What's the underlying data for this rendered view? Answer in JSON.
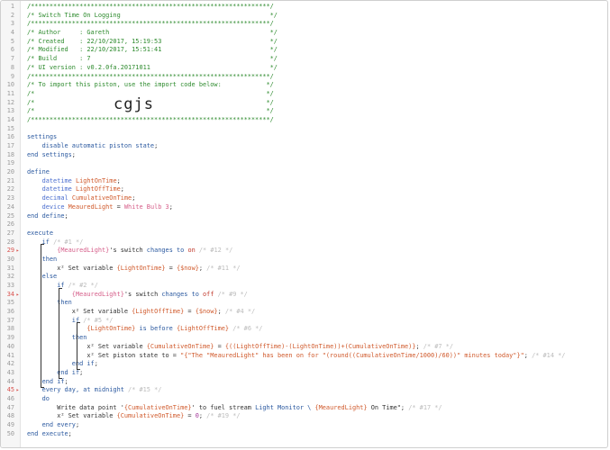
{
  "editor": {
    "import_code": "cgjs",
    "lines": [
      {
        "n": "1",
        "tokens": [
          {
            "c": "cmt",
            "t": "/****************************************************************/"
          }
        ]
      },
      {
        "n": "2",
        "tokens": [
          {
            "c": "cmt",
            "t": "/* Switch Time On Logging                                        */"
          }
        ]
      },
      {
        "n": "3",
        "tokens": [
          {
            "c": "cmt",
            "t": "/****************************************************************/"
          }
        ]
      },
      {
        "n": "4",
        "tokens": [
          {
            "c": "cmt",
            "t": "/* Author     : Gareth                                           */"
          }
        ]
      },
      {
        "n": "5",
        "tokens": [
          {
            "c": "cmt",
            "t": "/* Created    : 22/10/2017, 15:19:53                             */"
          }
        ]
      },
      {
        "n": "6",
        "tokens": [
          {
            "c": "cmt",
            "t": "/* Modified   : 22/10/2017, 15:51:41                             */"
          }
        ]
      },
      {
        "n": "7",
        "tokens": [
          {
            "c": "cmt",
            "t": "/* Build      : 7                                                */"
          }
        ]
      },
      {
        "n": "8",
        "tokens": [
          {
            "c": "cmt",
            "t": "/* UI version : v0.2.0fa.20171011                                */"
          }
        ]
      },
      {
        "n": "9",
        "tokens": [
          {
            "c": "cmt",
            "t": "/****************************************************************/"
          }
        ]
      },
      {
        "n": "10",
        "tokens": [
          {
            "c": "cmt",
            "t": "/* To import this piston, use the import code below:            */"
          }
        ]
      },
      {
        "n": "11",
        "tokens": [
          {
            "c": "cmt",
            "t": "/*                                                              */"
          }
        ]
      },
      {
        "n": "12",
        "tokens": [
          {
            "c": "cmt",
            "t": "/*                                                              */"
          }
        ]
      },
      {
        "n": "13",
        "tokens": [
          {
            "c": "cmt",
            "t": "/*                                                              */"
          }
        ]
      },
      {
        "n": "14",
        "tokens": [
          {
            "c": "cmt",
            "t": "/****************************************************************/"
          }
        ]
      },
      {
        "n": "15",
        "tokens": []
      },
      {
        "n": "16",
        "tokens": [
          {
            "c": "kw",
            "t": "settings"
          }
        ]
      },
      {
        "n": "17",
        "tokens": [
          {
            "c": "txt",
            "t": "    "
          },
          {
            "c": "kw",
            "t": "disable automatic piston state"
          },
          {
            "c": "txt",
            "t": ";"
          }
        ]
      },
      {
        "n": "18",
        "tokens": [
          {
            "c": "kw",
            "t": "end settings"
          },
          {
            "c": "txt",
            "t": ";"
          }
        ]
      },
      {
        "n": "19",
        "tokens": []
      },
      {
        "n": "20",
        "tokens": [
          {
            "c": "kw",
            "t": "define"
          }
        ]
      },
      {
        "n": "21",
        "tokens": [
          {
            "c": "txt",
            "t": "    "
          },
          {
            "c": "type",
            "t": "datetime "
          },
          {
            "c": "var",
            "t": "LightOnTime"
          },
          {
            "c": "txt",
            "t": ";"
          }
        ]
      },
      {
        "n": "22",
        "tokens": [
          {
            "c": "txt",
            "t": "    "
          },
          {
            "c": "type",
            "t": "datetime "
          },
          {
            "c": "var",
            "t": "LightOffTime"
          },
          {
            "c": "txt",
            "t": ";"
          }
        ]
      },
      {
        "n": "23",
        "tokens": [
          {
            "c": "txt",
            "t": "    "
          },
          {
            "c": "type",
            "t": "decimal "
          },
          {
            "c": "var",
            "t": "CumulativeOnTime"
          },
          {
            "c": "txt",
            "t": ";"
          }
        ]
      },
      {
        "n": "24",
        "tokens": [
          {
            "c": "txt",
            "t": "    "
          },
          {
            "c": "type",
            "t": "device "
          },
          {
            "c": "var",
            "t": "MeauredLight"
          },
          {
            "c": "txt",
            "t": " = "
          },
          {
            "c": "dev",
            "t": "White Bulb 3"
          },
          {
            "c": "txt",
            "t": ";"
          }
        ]
      },
      {
        "n": "25",
        "tokens": [
          {
            "c": "kw",
            "t": "end define"
          },
          {
            "c": "txt",
            "t": ";"
          }
        ]
      },
      {
        "n": "26",
        "tokens": []
      },
      {
        "n": "27",
        "tokens": [
          {
            "c": "kw",
            "t": "execute"
          }
        ]
      },
      {
        "n": "28",
        "tokens": [
          {
            "c": "txt",
            "t": "    "
          },
          {
            "c": "kw",
            "t": "if"
          },
          {
            "c": "ghost",
            "t": " /* #1 */"
          }
        ]
      },
      {
        "n": "29",
        "err": true,
        "tokens": [
          {
            "c": "txt",
            "t": "        "
          },
          {
            "c": "dev",
            "t": "{MeauredLight}"
          },
          {
            "c": "txt",
            "t": "'s switch "
          },
          {
            "c": "kw",
            "t": "changes to "
          },
          {
            "c": "str",
            "t": "on"
          },
          {
            "c": "ghost",
            "t": " /* #12 */"
          }
        ]
      },
      {
        "n": "30",
        "tokens": [
          {
            "c": "txt",
            "t": "    "
          },
          {
            "c": "kw",
            "t": "then"
          }
        ]
      },
      {
        "n": "31",
        "tokens": [
          {
            "c": "txt",
            "t": "        x² Set variable "
          },
          {
            "c": "var",
            "t": "{LightOnTime}"
          },
          {
            "c": "txt",
            "t": " = "
          },
          {
            "c": "var",
            "t": "{$now}"
          },
          {
            "c": "txt",
            "t": ";"
          },
          {
            "c": "ghost",
            "t": " /* #11 */"
          }
        ]
      },
      {
        "n": "32",
        "tokens": [
          {
            "c": "txt",
            "t": "    "
          },
          {
            "c": "kw",
            "t": "else"
          }
        ]
      },
      {
        "n": "33",
        "tokens": [
          {
            "c": "txt",
            "t": "        "
          },
          {
            "c": "kw",
            "t": "if"
          },
          {
            "c": "ghost",
            "t": " /* #2 */"
          }
        ]
      },
      {
        "n": "34",
        "err": true,
        "tokens": [
          {
            "c": "txt",
            "t": "            "
          },
          {
            "c": "dev",
            "t": "{MeauredLight}"
          },
          {
            "c": "txt",
            "t": "'s switch "
          },
          {
            "c": "kw",
            "t": "changes to "
          },
          {
            "c": "str",
            "t": "off"
          },
          {
            "c": "ghost",
            "t": " /* #9 */"
          }
        ]
      },
      {
        "n": "35",
        "tokens": [
          {
            "c": "txt",
            "t": "        "
          },
          {
            "c": "kw",
            "t": "then"
          }
        ]
      },
      {
        "n": "36",
        "tokens": [
          {
            "c": "txt",
            "t": "            x² Set variable "
          },
          {
            "c": "var",
            "t": "{LightOffTime}"
          },
          {
            "c": "txt",
            "t": " = "
          },
          {
            "c": "var",
            "t": "{$now}"
          },
          {
            "c": "txt",
            "t": ";"
          },
          {
            "c": "ghost",
            "t": " /* #4 */"
          }
        ]
      },
      {
        "n": "37",
        "tokens": [
          {
            "c": "txt",
            "t": "            "
          },
          {
            "c": "kw",
            "t": "if"
          },
          {
            "c": "ghost",
            "t": " /* #5 */"
          }
        ]
      },
      {
        "n": "38",
        "tokens": [
          {
            "c": "txt",
            "t": "                "
          },
          {
            "c": "var",
            "t": "{LightOnTime}"
          },
          {
            "c": "txt",
            "t": " "
          },
          {
            "c": "kw",
            "t": "is before "
          },
          {
            "c": "var",
            "t": "{LightOffTime}"
          },
          {
            "c": "ghost",
            "t": " /* #6 */"
          }
        ]
      },
      {
        "n": "39",
        "tokens": [
          {
            "c": "txt",
            "t": "            "
          },
          {
            "c": "kw",
            "t": "then"
          }
        ]
      },
      {
        "n": "40",
        "tokens": [
          {
            "c": "txt",
            "t": "                x² Set variable "
          },
          {
            "c": "var",
            "t": "{CumulativeOnTime}"
          },
          {
            "c": "txt",
            "t": " = "
          },
          {
            "c": "var",
            "t": "{((LightOffTime)-(LightOnTime))+(CumulativeOnTime)}"
          },
          {
            "c": "txt",
            "t": ";"
          },
          {
            "c": "ghost",
            "t": " /* #7 */"
          }
        ]
      },
      {
        "n": "41",
        "tokens": [
          {
            "c": "txt",
            "t": "                x² Set piston state to = "
          },
          {
            "c": "var",
            "t": "\"{\"The \"MeauredLight\" has been on for \"(round((CumulativeOnTime/1000)/60))\" minutes today\"}\""
          },
          {
            "c": "txt",
            "t": ";"
          },
          {
            "c": "ghost",
            "t": " /* #14 */"
          }
        ]
      },
      {
        "n": "42",
        "tokens": [
          {
            "c": "txt",
            "t": "            "
          },
          {
            "c": "kw",
            "t": "end if"
          },
          {
            "c": "txt",
            "t": ";"
          }
        ]
      },
      {
        "n": "43",
        "tokens": [
          {
            "c": "txt",
            "t": "        "
          },
          {
            "c": "kw",
            "t": "end if"
          },
          {
            "c": "txt",
            "t": ";"
          }
        ]
      },
      {
        "n": "44",
        "tokens": [
          {
            "c": "txt",
            "t": "    "
          },
          {
            "c": "kw",
            "t": "end if"
          },
          {
            "c": "txt",
            "t": ";"
          }
        ]
      },
      {
        "n": "45",
        "err": true,
        "tokens": [
          {
            "c": "txt",
            "t": "    "
          },
          {
            "c": "kw",
            "t": "every day, at midnight"
          },
          {
            "c": "ghost",
            "t": " /* #15 */"
          }
        ]
      },
      {
        "n": "46",
        "tokens": [
          {
            "c": "txt",
            "t": "    "
          },
          {
            "c": "kw",
            "t": "do"
          }
        ]
      },
      {
        "n": "47",
        "tokens": [
          {
            "c": "txt",
            "t": "        Write data point '"
          },
          {
            "c": "var",
            "t": "{CumulativeOnTime}"
          },
          {
            "c": "txt",
            "t": "' to fuel stream "
          },
          {
            "c": "kw",
            "t": "Light Monitor \\ "
          },
          {
            "c": "var",
            "t": "{MeauredLight}"
          },
          {
            "c": "txt",
            "t": " On Time\""
          },
          {
            "c": "txt",
            "t": ";"
          },
          {
            "c": "ghost",
            "t": " /* #17 */"
          }
        ]
      },
      {
        "n": "48",
        "tokens": [
          {
            "c": "txt",
            "t": "        x² Set variable "
          },
          {
            "c": "var",
            "t": "{CumulativeOnTime}"
          },
          {
            "c": "txt",
            "t": " = "
          },
          {
            "c": "num",
            "t": "0"
          },
          {
            "c": "txt",
            "t": ";"
          },
          {
            "c": "ghost",
            "t": " /* #19 */"
          }
        ]
      },
      {
        "n": "49",
        "tokens": [
          {
            "c": "txt",
            "t": "    "
          },
          {
            "c": "kw",
            "t": "end every"
          },
          {
            "c": "txt",
            "t": ";"
          }
        ]
      },
      {
        "n": "50",
        "tokens": [
          {
            "c": "kw",
            "t": "end execute"
          },
          {
            "c": "txt",
            "t": ";"
          }
        ]
      }
    ]
  },
  "icons": {
    "error_marker": "error-marker-icon"
  }
}
